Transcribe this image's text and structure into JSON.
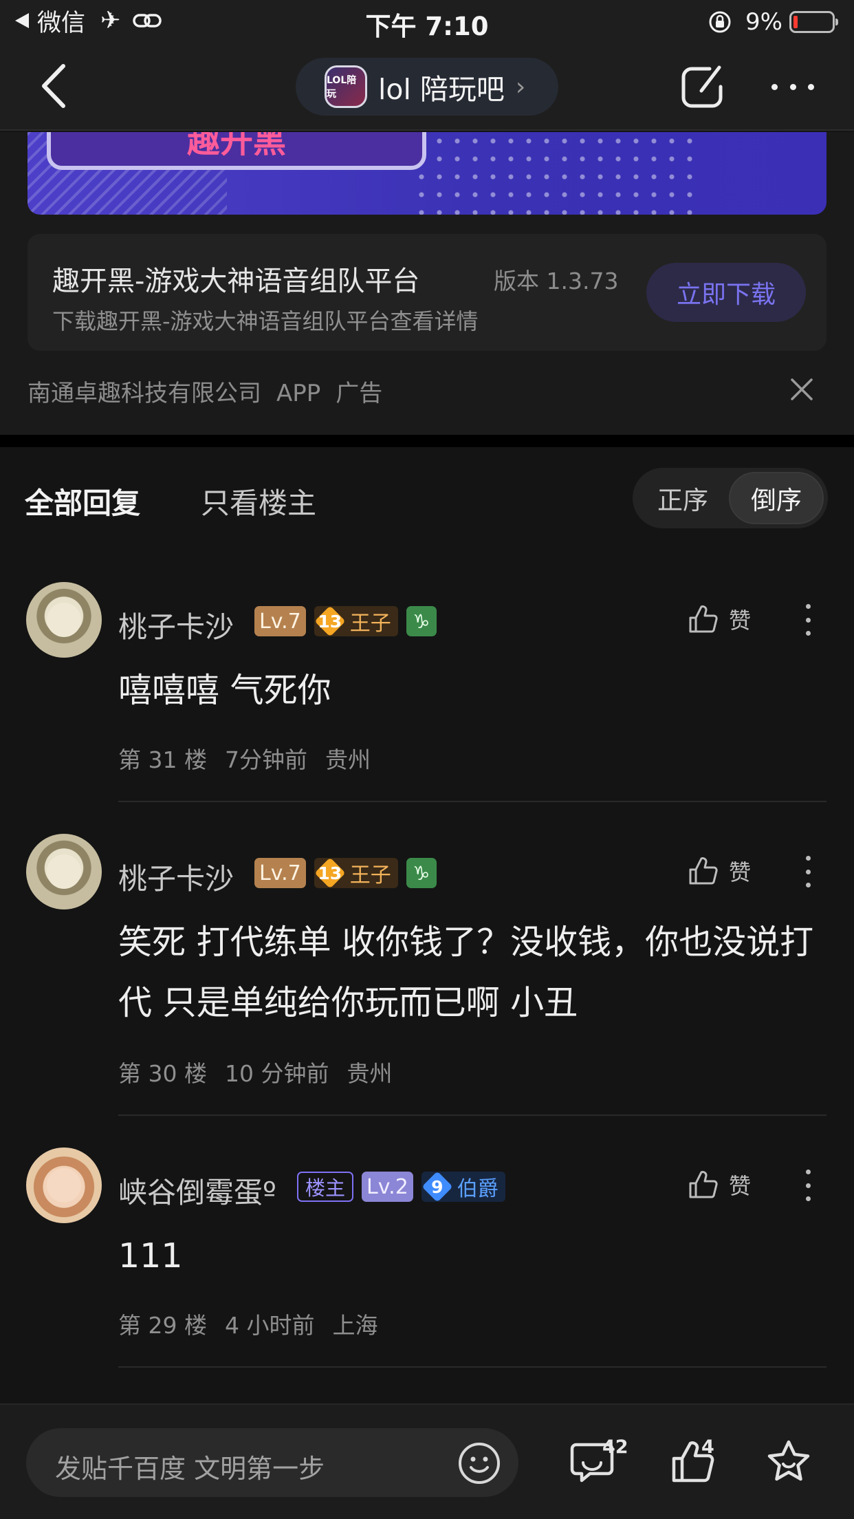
{
  "status_bar": {
    "back_app": "微信",
    "time": "下午 7:10",
    "battery": "9%"
  },
  "nav": {
    "forum_logo_text": "LOL陪玩",
    "forum_name": "lol 陪玩吧",
    "chevron": "›"
  },
  "ad": {
    "banner_logo": "趣开黑",
    "title": "趣开黑-游戏大神语音组队平台",
    "version": "版本 1.3.73",
    "description": "下载趣开黑-游戏大神语音组队平台查看详情",
    "download_label": "立即下载",
    "company": "南通卓趣科技有限公司",
    "type": "APP",
    "ad_label": "广告"
  },
  "tabs": {
    "all_replies": "全部回复",
    "op_only": "只看楼主",
    "sort_asc": "正序",
    "sort_desc": "倒序"
  },
  "comments": [
    {
      "username": "桃子卡沙",
      "level": "Lv.7",
      "rank_num": "13",
      "rank_title": "王子",
      "zodiac": "♑",
      "text": "嘻嘻嘻 气死你",
      "floor": "第 31 楼",
      "time": "7分钟前",
      "location": "贵州",
      "like_label": "赞"
    },
    {
      "username": "桃子卡沙",
      "level": "Lv.7",
      "rank_num": "13",
      "rank_title": "王子",
      "zodiac": "♑",
      "text": "笑死 打代练单 收你钱了？没收钱，你也没说打代 只是单纯给你玩而已啊 小丑",
      "floor": "第 30 楼",
      "time": "10 分钟前",
      "location": "贵州",
      "like_label": "赞"
    },
    {
      "username": "峡谷倒霉蛋º",
      "host_badge": "楼主",
      "level": "Lv.2",
      "rank_num": "9",
      "rank_title": "伯爵",
      "text": "111",
      "floor": "第 29 楼",
      "time": "4 小时前",
      "location": "上海",
      "like_label": "赞"
    }
  ],
  "bottom": {
    "placeholder": "发贴千百度 文明第一步",
    "comment_count": "42",
    "like_count": "4"
  },
  "colors": {
    "background": "#141414",
    "accent": "#7a73f0",
    "host_badge": "#7f72f5"
  }
}
